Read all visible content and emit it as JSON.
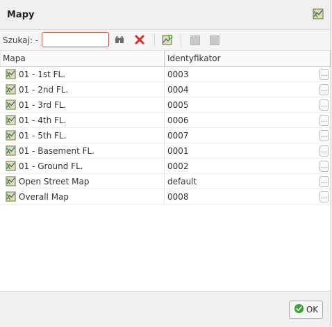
{
  "window": {
    "title": "Mapy"
  },
  "toolbar": {
    "search_label": "Szukaj: -",
    "search_value": ""
  },
  "grid": {
    "columns": [
      "Mapa",
      "Identyfikator"
    ],
    "rows": [
      {
        "map": "01 - 1st FL.",
        "id": "0003"
      },
      {
        "map": "01 - 2nd FL.",
        "id": "0004"
      },
      {
        "map": "01 - 3rd FL.",
        "id": "0005"
      },
      {
        "map": "01 - 4th FL.",
        "id": "0006"
      },
      {
        "map": "01 - 5th FL.",
        "id": "0007"
      },
      {
        "map": "01 - Basement FL.",
        "id": "0001"
      },
      {
        "map": "01 - Ground FL.",
        "id": "0002"
      },
      {
        "map": "Open Street Map",
        "id": "default"
      },
      {
        "map": "Overall Map",
        "id": "0008"
      }
    ],
    "row_action_label": "..."
  },
  "footer": {
    "ok_label": "OK"
  },
  "icons": {
    "map": "map-icon",
    "find": "binoculars-icon",
    "clear": "red-x-icon",
    "add": "add-map-icon",
    "check": "green-check-icon"
  },
  "colors": {
    "search_border": "#c35d3e",
    "clear_icon": "#d93025",
    "ok_check": "#3aa335"
  }
}
